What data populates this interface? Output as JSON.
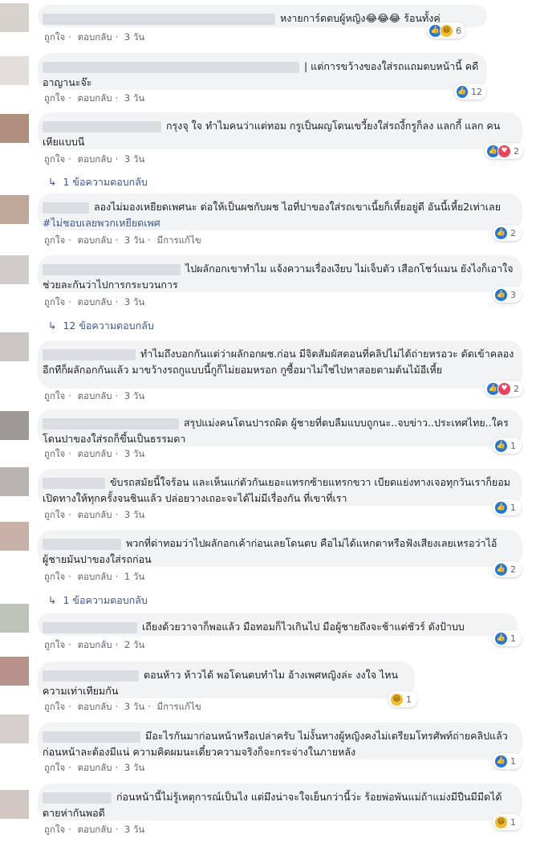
{
  "labels": {
    "like": "ถูกใจ",
    "reply": "ตอบกลับ",
    "edited": "มีการแก้ไข",
    "sep": "·"
  },
  "comments": [
    {
      "text": "หงายการ์ดตบผู้หญิง😂😂😂 ร้อนทั้งคู่",
      "time": "3 วัน",
      "reactions": [
        "like",
        "haha"
      ],
      "count": "6"
    },
    {
      "text": "| แต่การขว้างของใส่รถแถมตบหน้านี้ คดีอาญานะจ๊ะ",
      "time": "3 วัน",
      "reactions": [
        "like"
      ],
      "count": "12"
    },
    {
      "text": "กรุงจุ ใจ ทำไมคนว่าแต่ทอม กรูเป็นผญโดนเขวี้ยงใส่รถงี้กรูก็ลง แลกกี้ แลก คนเหียแบบนี",
      "time": "3 วัน",
      "reactions": [
        "like",
        "love"
      ],
      "count": "2",
      "replies": "1 ข้อความตอบกลับ"
    },
    {
      "text": "ลองไม่มองเหยียดเพศนะ ต่อให้เป็นผชกับผช ไอที่ปาของใส่รถเขาเนี้ยก็เหี้ยอยู่ดี อันนี้เหี้ย2เท่าเลย",
      "tag": "#ไม่ชอบเลยพวกเหยียดเพศ",
      "time": "3 วัน",
      "edited": true,
      "reactions": [
        "like"
      ],
      "count": "2"
    },
    {
      "text": "ไปผลักอกเขาทำไม แจ้งความเรื่องเงียบ ไม่เจ็บตัว เสือกโชว์แมน ยังไงก็เอาใจช่วยละกันว่าไปการกระบวนการ",
      "time": "3 วัน",
      "reactions": [
        "like"
      ],
      "count": "3",
      "replies": "12 ข้อความตอบกลับ"
    },
    {
      "text": "ทำไมถึงบอกกันแต่ว่าผลักอกผช.ก่อน มีจิตสัมผัสตอนที่คลิปไม่ได้ถ่ายหรอวะ ดัดเข้าคลองอีกทีก็ผลักอกกันแล้ว มาขว้างรถกูแบบนี้กูก็ไม่ยอมหรอก กูซื้อมาไม่ใช่ไปหาสอยตามต้นไม้อีเหี้ย",
      "time": "3 วัน",
      "reactions": [
        "like",
        "love"
      ],
      "count": "2"
    },
    {
      "text": "สรุปแม่งคนโดนปารถผิด ผู้ชายที่ตบลืมแบบถูกนะ..จบข่าว..ประเทศไทย..ใครโดนปาของใส่รถก็ขึ้นเป็นธรรมดา",
      "time": "3 วัน",
      "reactions": [
        "like"
      ],
      "count": "1"
    },
    {
      "text": "ขับรถสมัยนี้ใจร้อน และเห็นแก่ตัวกันเยอะแทรกซ้ายแทรกขวา เบียดแย่งทางเจอทุกวันเราก็ยอมเปิดทางให้ทุกครั้งจนชินแล้ว ปล่อยวางเถอะจะได้ไม่มีเรื่องกัน ที่เขาที่เรา",
      "time": "3 วัน",
      "reactions": [
        "like"
      ],
      "count": "1"
    },
    {
      "text": "พวกที่ด่าทอมว่าไปผลักอกเค้าก่อนเลยโดนตบ คือไม่ได้แหกตาหรือฟังเสียงเลยเหรอว่าไอ้ผู้ชายมันปาของใส่รถก่อน",
      "time": "1 วัน",
      "reactions": [
        "like"
      ],
      "count": "2",
      "replies": "1 ข้อความตอบกลับ"
    },
    {
      "text": "เถียงด้วยวาจาก็พอแล้ว มือทอมก็ไวเกินไป มือผู้ชายถึงจะช้าแต่ชัวร์ ดังป้าบบ",
      "time": "2 วัน",
      "reactions": [
        "like"
      ],
      "count": "1"
    },
    {
      "text": "ตอนห้าว ห้าวได้ พอโดนตบทำไม อ้างเพศหญิงล่ะ งงใจ ไหนความเท่าเทียมกัน",
      "time": "3 วัน",
      "edited": true,
      "reactions": [
        "haha"
      ],
      "count": "1"
    },
    {
      "text": "มึอะไรกันมาก่อนหน้าหรือเปล่าครับ ไม่งั้นทางผู้หญิงคงไม่เตรียมโทรศัพท์ถ่ายคลิปแล้วก่อนหน้าละต้องมีแน่ ความคิดผมนะเดี๋ยวความจริงก็จะกระจ่างในภายหลัง",
      "time": "3 วัน",
      "reactions": [
        "like"
      ],
      "count": "1"
    },
    {
      "text": "ก่อนหน้านี้ไม่รู้เหตุการณ์เป็นไง แต่มึงน่าจะใจเย็นกว่านี้ว่ะ ร้อยพ่อพันแม่ถ้าแม่งมีปืนมีมีดได้ตายห่ากันพอดี",
      "time": "3 วัน",
      "reactions": [
        "haha"
      ],
      "count": "1"
    }
  ]
}
